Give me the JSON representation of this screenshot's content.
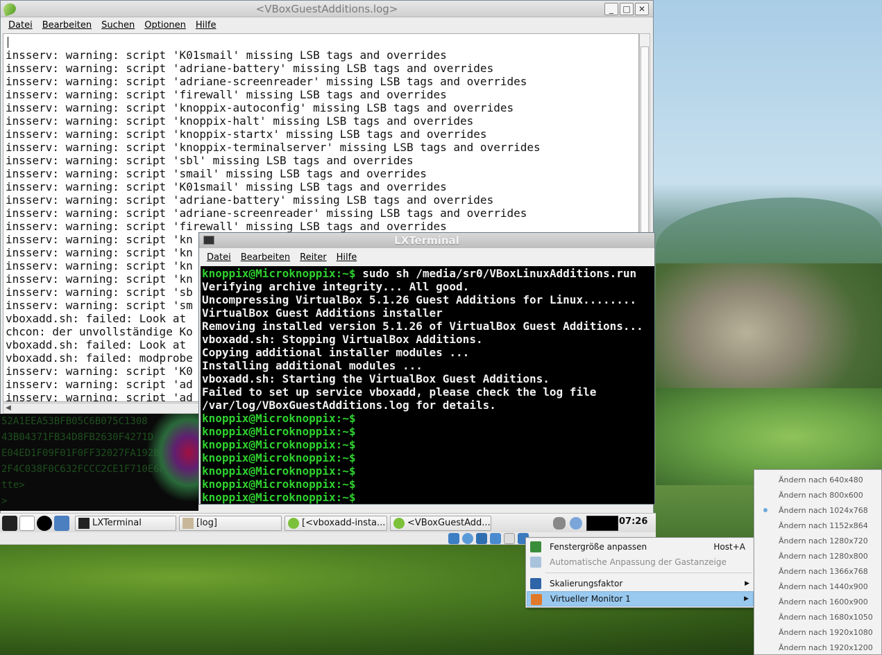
{
  "log_window": {
    "title": "<VBoxGuestAdditions.log>",
    "menu": [
      "Datei",
      "Bearbeiten",
      "Suchen",
      "Optionen",
      "Hilfe"
    ],
    "buttons": {
      "minimize": "_",
      "maximize": "□",
      "close": "✕"
    },
    "lines": [
      "insserv: warning: script 'K01smail' missing LSB tags and overrides",
      "insserv: warning: script 'adriane-battery' missing LSB tags and overrides",
      "insserv: warning: script 'adriane-screenreader' missing LSB tags and overrides",
      "insserv: warning: script 'firewall' missing LSB tags and overrides",
      "insserv: warning: script 'knoppix-autoconfig' missing LSB tags and overrides",
      "insserv: warning: script 'knoppix-halt' missing LSB tags and overrides",
      "insserv: warning: script 'knoppix-startx' missing LSB tags and overrides",
      "insserv: warning: script 'knoppix-terminalserver' missing LSB tags and overrides",
      "insserv: warning: script 'sbl' missing LSB tags and overrides",
      "insserv: warning: script 'smail' missing LSB tags and overrides",
      "insserv: warning: script 'K01smail' missing LSB tags and overrides",
      "insserv: warning: script 'adriane-battery' missing LSB tags and overrides",
      "insserv: warning: script 'adriane-screenreader' missing LSB tags and overrides",
      "insserv: warning: script 'firewall' missing LSB tags and overrides",
      "insserv: warning: script 'kn",
      "insserv: warning: script 'kn",
      "insserv: warning: script 'kn",
      "insserv: warning: script 'kn",
      "insserv: warning: script 'sb",
      "insserv: warning: script 'sm",
      "vboxadd.sh: failed: Look at",
      "chcon: der unvollständige Ko",
      "vboxadd.sh: failed: Look at",
      "vboxadd.sh: failed: modprobe",
      "insserv: warning: script 'K0",
      "insserv: warning: script 'ad",
      "insserv: warning: script 'ad"
    ]
  },
  "bg_terminal": {
    "lines": [
      "52A1EEA53BFB05C6B075C1308",
      "43B04371FB34D8FB2630F4271D",
      "E04ED1F09F01F0FF32027FA192BF",
      "2F4C038F0C632FCCC2CE1F710E6FF2",
      "tte>",
      ">"
    ]
  },
  "terminal": {
    "title": "LXTerminal",
    "menu": [
      "Datei",
      "Bearbeiten",
      "Reiter",
      "Hilfe"
    ],
    "prompt": "knoppix@Microknoppix:~$",
    "command": " sudo sh /media/sr0/VBoxLinuxAdditions.run",
    "output": [
      "Verifying archive integrity... All good.",
      "Uncompressing VirtualBox 5.1.26 Guest Additions for Linux........",
      "VirtualBox Guest Additions installer",
      "Removing installed version 5.1.26 of VirtualBox Guest Additions...",
      "vboxadd.sh: Stopping VirtualBox Additions.",
      "Copying additional installer modules ...",
      "Installing additional modules ...",
      "vboxadd.sh: Starting the VirtualBox Guest Additions.",
      "Failed to set up service vboxadd, please check the log file",
      "/var/log/VBoxGuestAdditions.log for details."
    ],
    "empty_prompt_count": 7
  },
  "taskbar": {
    "tasks": [
      "LXTerminal",
      "[log]",
      "[<vboxadd-insta...",
      "<VBoxGuestAdd..."
    ],
    "clock": "07:26"
  },
  "context_menu": {
    "items": [
      {
        "label": "Fenstergröße anpassen",
        "shortcut": "Host+A",
        "disabled": false
      },
      {
        "label": "Automatische Anpassung der Gastanzeige",
        "shortcut": "",
        "disabled": true
      },
      {
        "label": "Skalierungsfaktor",
        "submenu": true
      },
      {
        "label": "Virtueller Monitor 1",
        "submenu": true,
        "selected": true
      }
    ]
  },
  "submenu": {
    "items": [
      "Ändern nach 640x480",
      "Ändern nach 800x600",
      "Ändern nach 1024x768",
      "Ändern nach 1152x864",
      "Ändern nach 1280x720",
      "Ändern nach 1280x800",
      "Ändern nach 1366x768",
      "Ändern nach 1440x900",
      "Ändern nach 1600x900",
      "Ändern nach 1680x1050",
      "Ändern nach 1920x1080",
      "Ändern nach 1920x1200"
    ],
    "checked": "Ändern nach 1024x768"
  },
  "colors": {
    "prompt_green": "#2fd12f",
    "menu_highlight": "#99c9ef"
  }
}
